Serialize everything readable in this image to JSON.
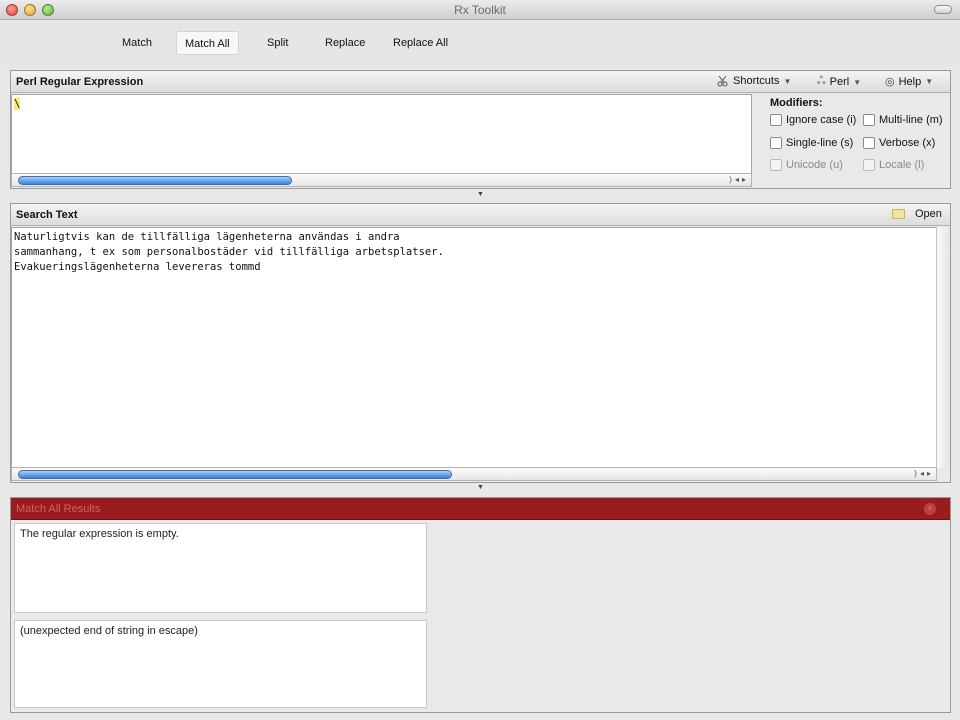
{
  "window": {
    "title": "Rx Toolkit"
  },
  "toolbar": {
    "buttons": [
      {
        "label": "Match"
      },
      {
        "label": "Match All",
        "active": true
      },
      {
        "label": "Split"
      },
      {
        "label": "Replace"
      },
      {
        "label": "Replace All"
      }
    ]
  },
  "regex_pane": {
    "title": "Perl Regular Expression",
    "menus": {
      "shortcuts": "Shortcuts",
      "perl": "Perl",
      "help": "Help"
    },
    "value": "\\",
    "modifiers_title": "Modifiers:",
    "modifiers": [
      {
        "label": "Ignore case (i)",
        "checked": false,
        "enabled": true
      },
      {
        "label": "Multi-line (m)",
        "checked": false,
        "enabled": true
      },
      {
        "label": "Single-line (s)",
        "checked": false,
        "enabled": true
      },
      {
        "label": "Verbose (x)",
        "checked": false,
        "enabled": true
      },
      {
        "label": "Unicode (u)",
        "checked": false,
        "enabled": false
      },
      {
        "label": "Locale (l)",
        "checked": false,
        "enabled": false
      }
    ]
  },
  "search_pane": {
    "title": "Search Text",
    "open_label": "Open",
    "text_lines": [
      "Naturligtvis kan de tillfälliga lägenheterna användas i andra",
      "sammanhang, t ex som personalbostäder vid tillfälliga arbetsplatser.",
      "Evakueringslägenheterna levereras tommd"
    ]
  },
  "results_pane": {
    "title": "Match All Results",
    "close_label": "×",
    "message": "The regular expression is empty.",
    "error": "(unexpected end of string in escape)"
  },
  "colors": {
    "results_header": "#9a1c1c",
    "scroll_thumb": "#3d80d6"
  },
  "icons": {
    "shortcuts": "scissors-icon",
    "perl": "camel-icon",
    "help": "help-icon",
    "open": "folder-icon"
  }
}
